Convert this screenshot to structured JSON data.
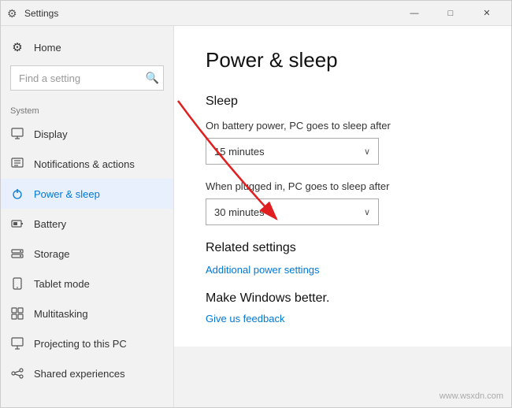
{
  "window": {
    "title": "Settings"
  },
  "titlebar": {
    "title": "Settings",
    "minimize_label": "—",
    "maximize_label": "□",
    "close_label": "✕"
  },
  "sidebar": {
    "search_placeholder": "Find a setting",
    "section_label": "System",
    "items": [
      {
        "id": "home",
        "icon": "⚙",
        "label": "Home"
      },
      {
        "id": "display",
        "icon": "🖥",
        "label": "Display"
      },
      {
        "id": "notifications",
        "icon": "🔔",
        "label": "Notifications & actions"
      },
      {
        "id": "power-sleep",
        "icon": "⏻",
        "label": "Power & sleep",
        "active": true
      },
      {
        "id": "battery",
        "icon": "🔋",
        "label": "Battery"
      },
      {
        "id": "storage",
        "icon": "💾",
        "label": "Storage"
      },
      {
        "id": "tablet-mode",
        "icon": "📱",
        "label": "Tablet mode"
      },
      {
        "id": "multitasking",
        "icon": "⊞",
        "label": "Multitasking"
      },
      {
        "id": "projecting",
        "icon": "📡",
        "label": "Projecting to this PC"
      },
      {
        "id": "shared",
        "icon": "🔗",
        "label": "Shared experiences"
      }
    ]
  },
  "main": {
    "page_title": "Power & sleep",
    "sleep_section": {
      "title": "Sleep",
      "battery_label": "On battery power, PC goes to sleep after",
      "battery_value": "15 minutes",
      "plugged_label": "When plugged in, PC goes to sleep after",
      "plugged_value": "30 minutes"
    },
    "related_section": {
      "title": "Related settings",
      "link_label": "Additional power settings"
    },
    "make_better_section": {
      "title": "Make Windows better.",
      "link_label": "Give us feedback"
    }
  },
  "watermark": {
    "text": "www.wsxdn.com"
  }
}
